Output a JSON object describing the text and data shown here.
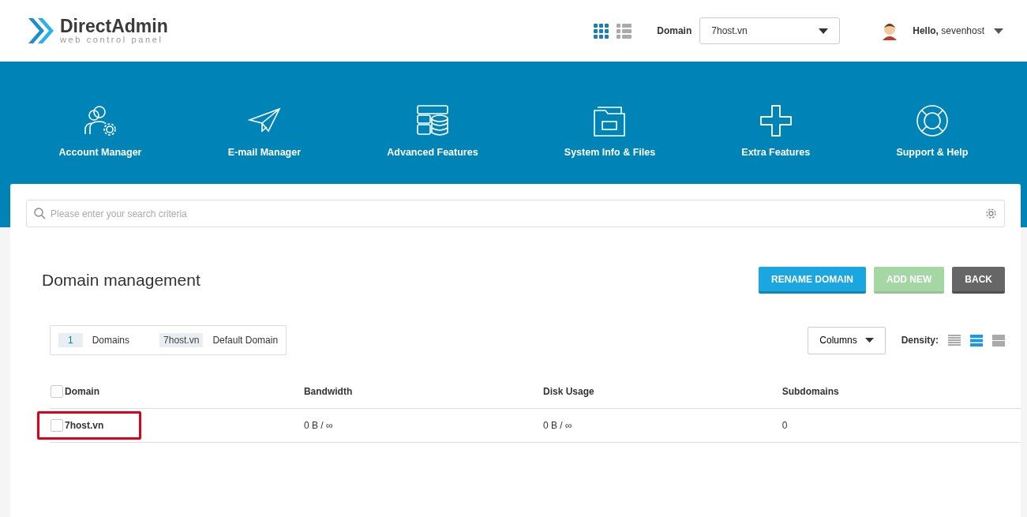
{
  "header": {
    "logo": {
      "name": "DirectAdmin",
      "tagline": "web control panel"
    },
    "views": [
      {
        "kind": "grid",
        "selected": true
      },
      {
        "kind": "list",
        "selected": false
      }
    ],
    "domain_label": "Domain",
    "domain_select": "7host.vn",
    "greeting": "**Hello,** sevenhost"
  },
  "nav": [
    {
      "label": "Account Manager"
    },
    {
      "label": "E-mail Manager"
    },
    {
      "label": "Advanced Features"
    },
    {
      "label": "System Info & Files"
    },
    {
      "label": "Extra Features"
    },
    {
      "label": "Support & Help"
    }
  ],
  "search": {
    "placeholder": "Please enter your search criteria"
  },
  "page": {
    "title": "Domain management",
    "buttons": [
      {
        "label": "RENAME DOMAIN",
        "kind": "primary",
        "disabled": false
      },
      {
        "label": "ADD NEW",
        "kind": "success",
        "disabled": true
      },
      {
        "label": "BACK",
        "kind": "neutral",
        "disabled": false
      }
    ],
    "summary": [
      {
        "value": "1",
        "label": "Domains"
      },
      {
        "value": "7host.vn",
        "label": "Default Domain"
      }
    ],
    "columns_button": "Columns",
    "density_label": "Density:",
    "density": [
      {
        "kind": "compact",
        "selected": false
      },
      {
        "kind": "normal",
        "selected": true
      },
      {
        "kind": "large",
        "selected": false
      }
    ]
  },
  "table": {
    "select_all": false,
    "columns": [
      "Domain",
      "Bandwidth",
      "Disk Usage",
      "Subdomains"
    ],
    "rows": [
      {
        "checked": false,
        "highlighted": true,
        "cells": [
          "7host.vn",
          "0 B / ∞",
          "0 B / ∞",
          "0"
        ]
      }
    ]
  }
}
